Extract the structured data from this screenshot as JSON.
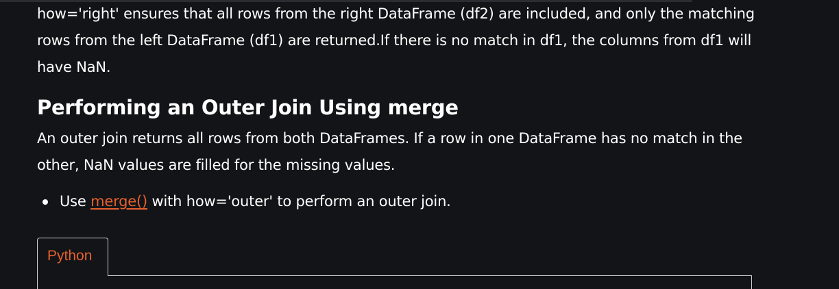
{
  "article": {
    "para_right_join": "how='right' ensures that all rows from the right DataFrame (df2) are included, and only the matching rows from the left DataFrame (df1) are returned.If there is no match in df1, the columns from df1 will have NaN.",
    "heading_outer_join": "Performing an Outer Join Using merge",
    "para_outer_join": "An outer join returns all rows from both DataFrames. If a row in one DataFrame has no match in the other, NaN values are filled for the missing values.",
    "bullet": {
      "prefix": "Use ",
      "link_text": "merge()",
      "suffix": " with how='outer' to perform an outer join."
    }
  },
  "code_tabs": {
    "active_label": "Python"
  },
  "colors": {
    "background": "#131417",
    "text": "#ffffff",
    "accent": "#e6612e",
    "border": "#cfd0d2"
  }
}
